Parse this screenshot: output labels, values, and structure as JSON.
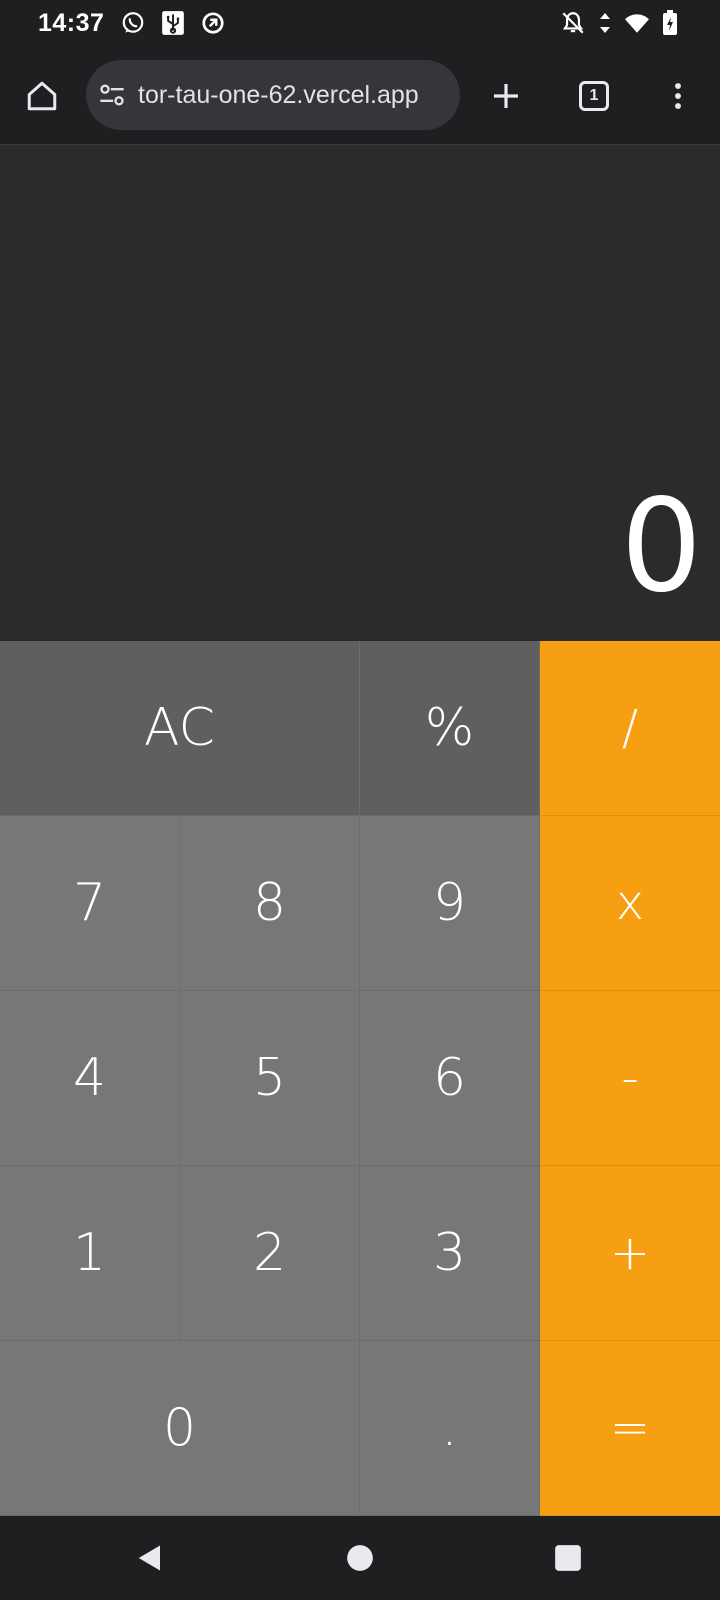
{
  "status_bar": {
    "time": "14:37",
    "left_icons": [
      "whatsapp-icon",
      "usb-icon",
      "data-saver-icon"
    ],
    "right_icons": [
      "notifications-off-icon",
      "data-transfer-icon",
      "wifi-icon",
      "battery-charging-icon"
    ]
  },
  "browser": {
    "url": "tor-tau-one-62.vercel.app",
    "tab_count": "1",
    "icons": [
      "home-icon",
      "site-settings-icon",
      "plus-icon",
      "tabs-icon",
      "more-vert-icon"
    ]
  },
  "calculator": {
    "display": "0",
    "keys": {
      "ac": "AC",
      "percent": "%",
      "divide": "/",
      "seven": "7",
      "eight": "8",
      "nine": "9",
      "multiply": "x",
      "four": "4",
      "five": "5",
      "six": "6",
      "minus": "-",
      "one": "1",
      "two": "2",
      "three": "3",
      "plus": "+",
      "zero": "0",
      "decimal": ".",
      "equals": "="
    }
  },
  "nav_bar": {
    "icons": [
      "back-icon",
      "home-icon",
      "recents-icon"
    ]
  },
  "colors": {
    "operator": "#f69f12",
    "top_row": "#5f5f5f",
    "number": "#777777",
    "display_bg": "#2b2b2b",
    "chrome": "#1e1f20"
  }
}
